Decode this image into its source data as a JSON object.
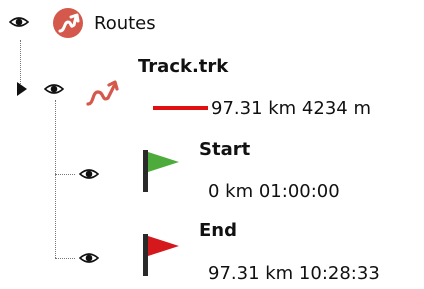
{
  "tree": {
    "root": {
      "label": "Routes",
      "icon": "route-icon"
    },
    "track": {
      "label": "Track.trk",
      "icon": "track-icon",
      "expand_icon": "expand-triangle-icon",
      "line_color": "#e01010",
      "stats": "97.31 km 4234 m"
    },
    "start": {
      "label": "Start",
      "info": "0 km 01:00:00",
      "flag_color": "#4cab3a",
      "icon": "green-flag-icon"
    },
    "end": {
      "label": "End",
      "info": "97.31 km 10:28:33",
      "flag_color": "#d4181c",
      "icon": "red-flag-icon"
    },
    "visibility_icon": "eye-icon"
  }
}
